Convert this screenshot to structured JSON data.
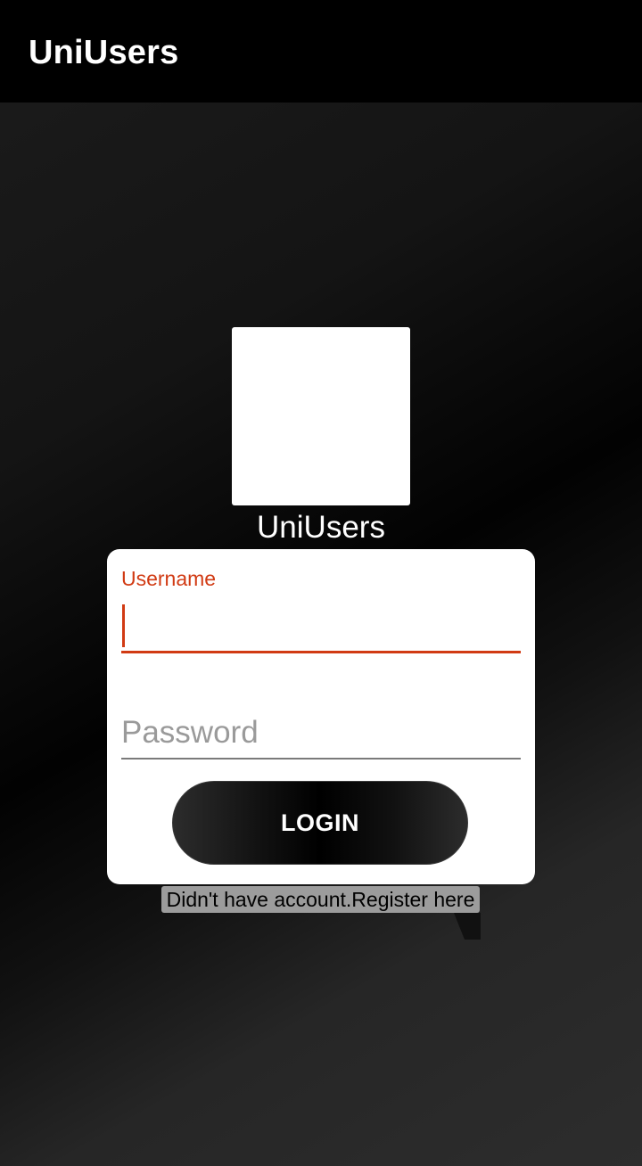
{
  "app_bar": {
    "title": "UniUsers"
  },
  "logo": {
    "label": "UniUsers"
  },
  "login_form": {
    "username": {
      "label": "Username",
      "value": ""
    },
    "password": {
      "placeholder": "Password",
      "value": ""
    },
    "login_label": "LOGIN"
  },
  "register_link": {
    "text": "Didn't have account.Register here"
  },
  "colors": {
    "accent": "#d13a13",
    "app_bar": "#000000",
    "card": "#ffffff"
  }
}
